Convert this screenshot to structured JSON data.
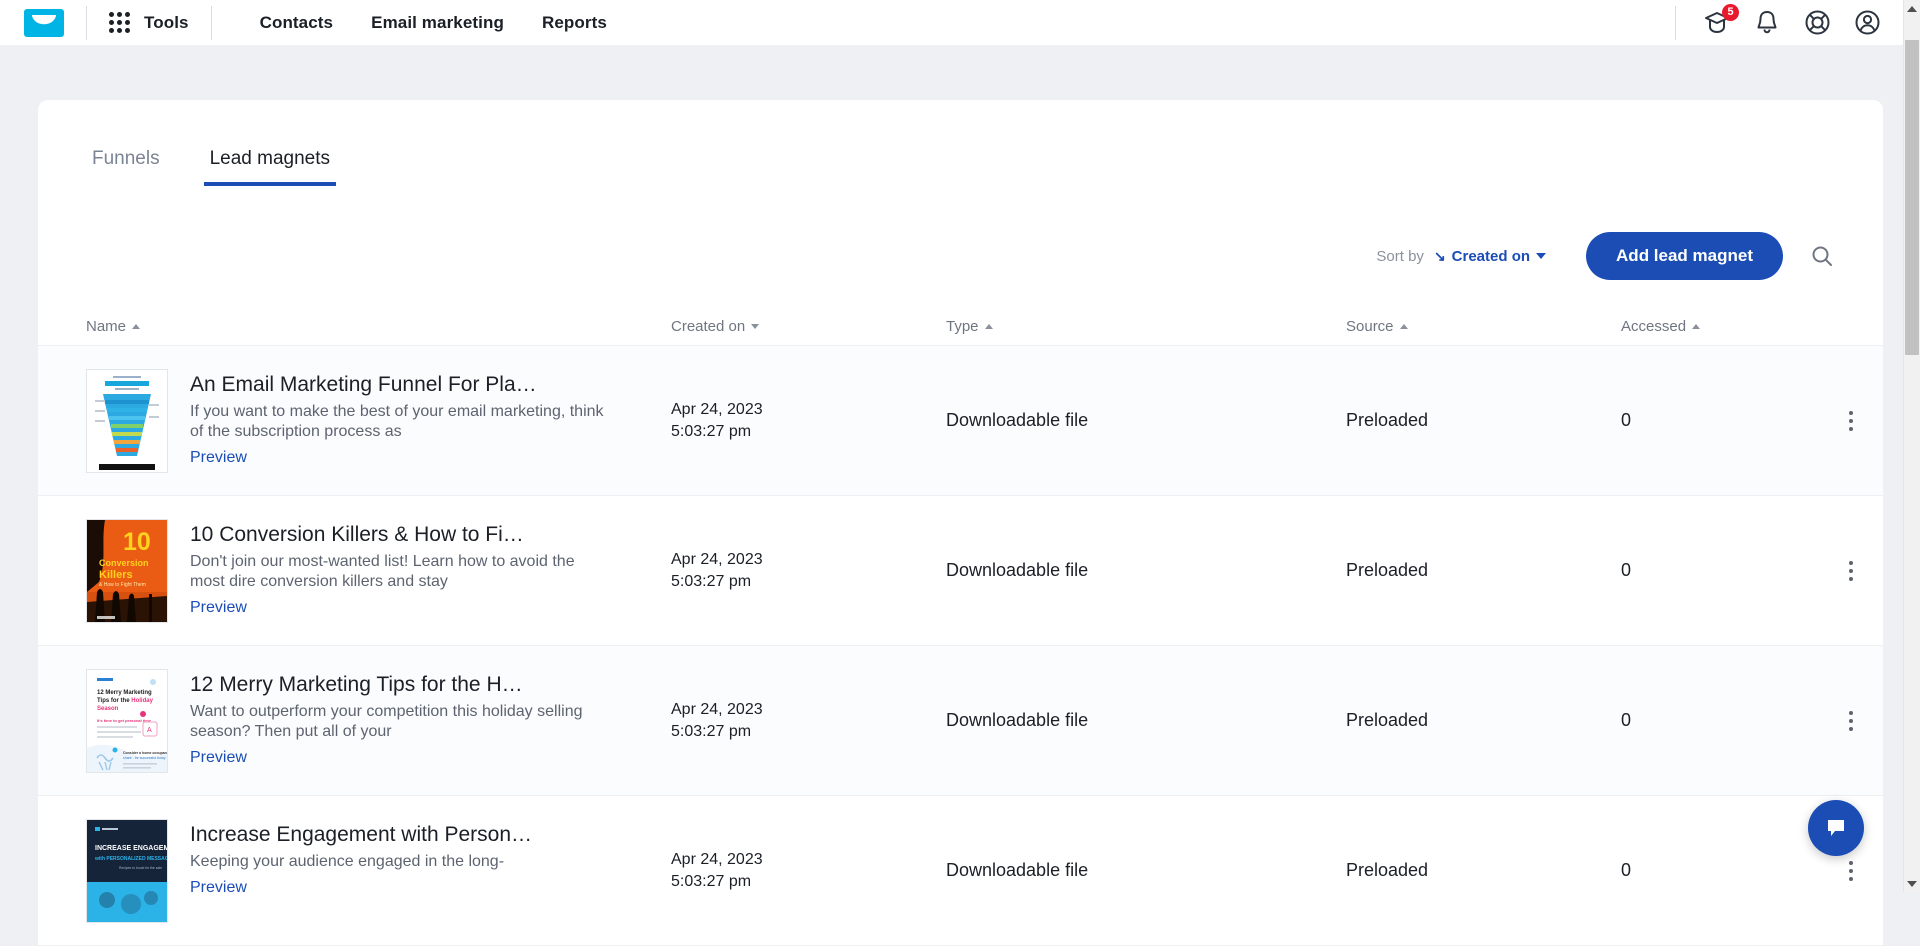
{
  "topnav": {
    "logo_name": "getresponse-envelope-logo",
    "tools_label": "Tools",
    "links": [
      {
        "label": "Contacts",
        "name": "nav-link-contacts"
      },
      {
        "label": "Email marketing",
        "name": "nav-link-email-marketing"
      },
      {
        "label": "Reports",
        "name": "nav-link-reports"
      }
    ],
    "icons": {
      "graduation": "graduation-cap-icon",
      "graduation_badge": "5",
      "bell": "bell-icon",
      "help": "life-ring-help-icon",
      "account": "account-avatar-icon"
    }
  },
  "tabs": [
    {
      "label": "Funnels",
      "active": false
    },
    {
      "label": "Lead magnets",
      "active": true
    }
  ],
  "toolbar": {
    "sort_label": "Sort by",
    "sort_value": "Created on",
    "sort_direction_glyph": "↘",
    "add_button": "Add lead magnet",
    "search_icon": "search-icon"
  },
  "table": {
    "columns": [
      {
        "label": "Name",
        "sort": "asc"
      },
      {
        "label": "Created on",
        "sort": "desc"
      },
      {
        "label": "Type",
        "sort": "asc"
      },
      {
        "label": "Source",
        "sort": "asc"
      },
      {
        "label": "Accessed",
        "sort": "asc"
      }
    ],
    "preview_label": "Preview",
    "rows": [
      {
        "title": "An Email Marketing Funnel For Pla…",
        "description": "If you want to make the best of your email marketing, think of the subscription process as",
        "date": "Apr 24, 2023",
        "time": "5:03:27 pm",
        "type": "Downloadable file",
        "source": "Preloaded",
        "accessed": "0",
        "thumb": "email-marketing-funnel-cover"
      },
      {
        "title": "10 Conversion Killers & How to Fi…",
        "description": "Don't join our most-wanted list! Learn how to avoid the most dire conversion killers and stay",
        "date": "Apr 24, 2023",
        "time": "5:03:27 pm",
        "type": "Downloadable file",
        "source": "Preloaded",
        "accessed": "0",
        "thumb": "conversion-killers-cover"
      },
      {
        "title": "12 Merry Marketing Tips for the H…",
        "description": "Want to outperform your competition this holiday selling season? Then put all of your",
        "date": "Apr 24, 2023",
        "time": "5:03:27 pm",
        "type": "Downloadable file",
        "source": "Preloaded",
        "accessed": "0",
        "thumb": "merry-marketing-tips-cover"
      },
      {
        "title": "Increase Engagement with Person…",
        "description": "Keeping your audience engaged in the long-",
        "date": "Apr 24, 2023",
        "time": "5:03:27 pm",
        "type": "Downloadable file",
        "source": "Preloaded",
        "accessed": "0",
        "thumb": "increase-engagement-cover"
      }
    ]
  },
  "chat": {
    "icon": "chat-bubble-icon"
  },
  "colors": {
    "brand_cyan": "#00b4e5",
    "accent_blue": "#1b4db5",
    "badge_red": "#e8192c",
    "page_bg": "#eef0f3"
  }
}
